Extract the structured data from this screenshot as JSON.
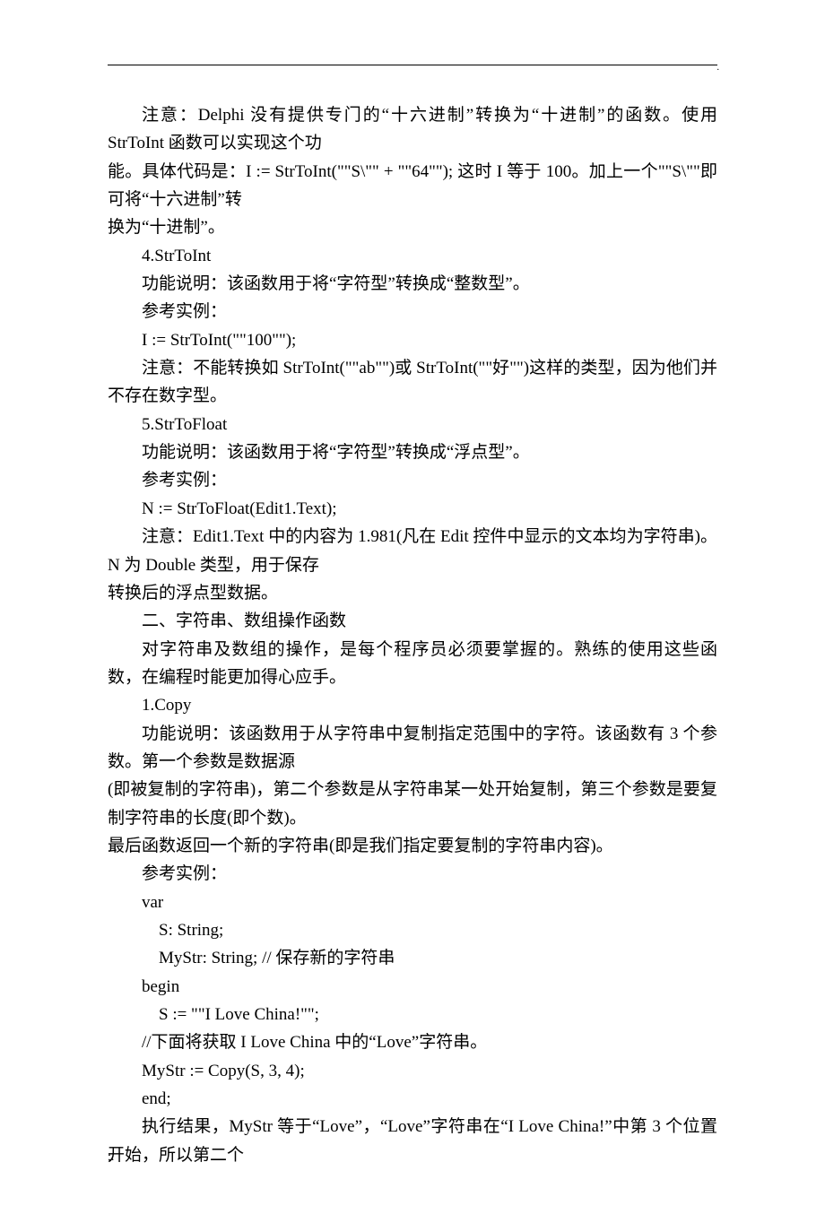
{
  "lines": [
    {
      "cls": "indent2",
      "text": "注意：Delphi 没有提供专门的“十六进制”转换为“十进制”的函数。使用 StrToInt 函数可以实现这个功"
    },
    {
      "cls": "noindent",
      "text": "能。具体代码是：I := StrToInt(\"\"S\\\"\" + \"\"64\"\");  这时 I 等于 100。加上一个\"\"S\\\"\"即可将“十六进制”转"
    },
    {
      "cls": "noindent",
      "text": "换为“十进制”。"
    },
    {
      "cls": "indent2",
      "text": "4.StrToInt"
    },
    {
      "cls": "indent2",
      "text": "功能说明：该函数用于将“字符型”转换成“整数型”。"
    },
    {
      "cls": "indent2",
      "text": "参考实例："
    },
    {
      "cls": "indent2",
      "text": "I := StrToInt(\"\"100\"\");"
    },
    {
      "cls": "indent2",
      "text": "注意：不能转换如 StrToInt(\"\"ab\"\")或 StrToInt(\"\"好\"\")这样的类型，因为他们并不存在数字型。"
    },
    {
      "cls": "indent2",
      "text": "5.StrToFloat"
    },
    {
      "cls": "indent2",
      "text": "功能说明：该函数用于将“字符型”转换成“浮点型”。"
    },
    {
      "cls": "indent2",
      "text": "参考实例："
    },
    {
      "cls": "indent2",
      "text": "N := StrToFloat(Edit1.Text);"
    },
    {
      "cls": "indent2",
      "text": "注意：Edit1.Text 中的内容为 1.981(凡在 Edit 控件中显示的文本均为字符串)。N 为 Double 类型，用于保存"
    },
    {
      "cls": "noindent",
      "text": "转换后的浮点型数据。"
    },
    {
      "cls": "indent2",
      "text": "二、字符串、数组操作函数"
    },
    {
      "cls": "indent2",
      "text": "对字符串及数组的操作，是每个程序员必须要掌握的。熟练的使用这些函数，在编程时能更加得心应手。"
    },
    {
      "cls": "indent2",
      "text": "1.Copy"
    },
    {
      "cls": "indent2",
      "text": "功能说明：该函数用于从字符串中复制指定范围中的字符。该函数有 3 个参数。第一个参数是数据源"
    },
    {
      "cls": "noindent",
      "text": "(即被复制的字符串)，第二个参数是从字符串某一处开始复制，第三个参数是要复制字符串的长度(即个数)。"
    },
    {
      "cls": "noindent",
      "text": "最后函数返回一个新的字符串(即是我们指定要复制的字符串内容)。"
    },
    {
      "cls": "indent2",
      "text": "参考实例："
    },
    {
      "cls": "indent2",
      "text": "var"
    },
    {
      "cls": "indent3",
      "text": "S: String;"
    },
    {
      "cls": "indent3",
      "text": "MyStr: String; //  保存新的字符串"
    },
    {
      "cls": "indent2",
      "text": "begin"
    },
    {
      "cls": "indent3",
      "text": "S := \"\"I Love China!\"\";"
    },
    {
      "cls": "indent2",
      "text": "//下面将获取 I Love China 中的“Love”字符串。"
    },
    {
      "cls": "indent2",
      "text": "MyStr := Copy(S, 3, 4);"
    },
    {
      "cls": "indent2",
      "text": "end;"
    },
    {
      "cls": "indent2",
      "text": "执行结果，MyStr 等于“Love”，“Love”字符串在“I Love China!”中第 3 个位置开始，所以第二个"
    }
  ],
  "footer": ";."
}
